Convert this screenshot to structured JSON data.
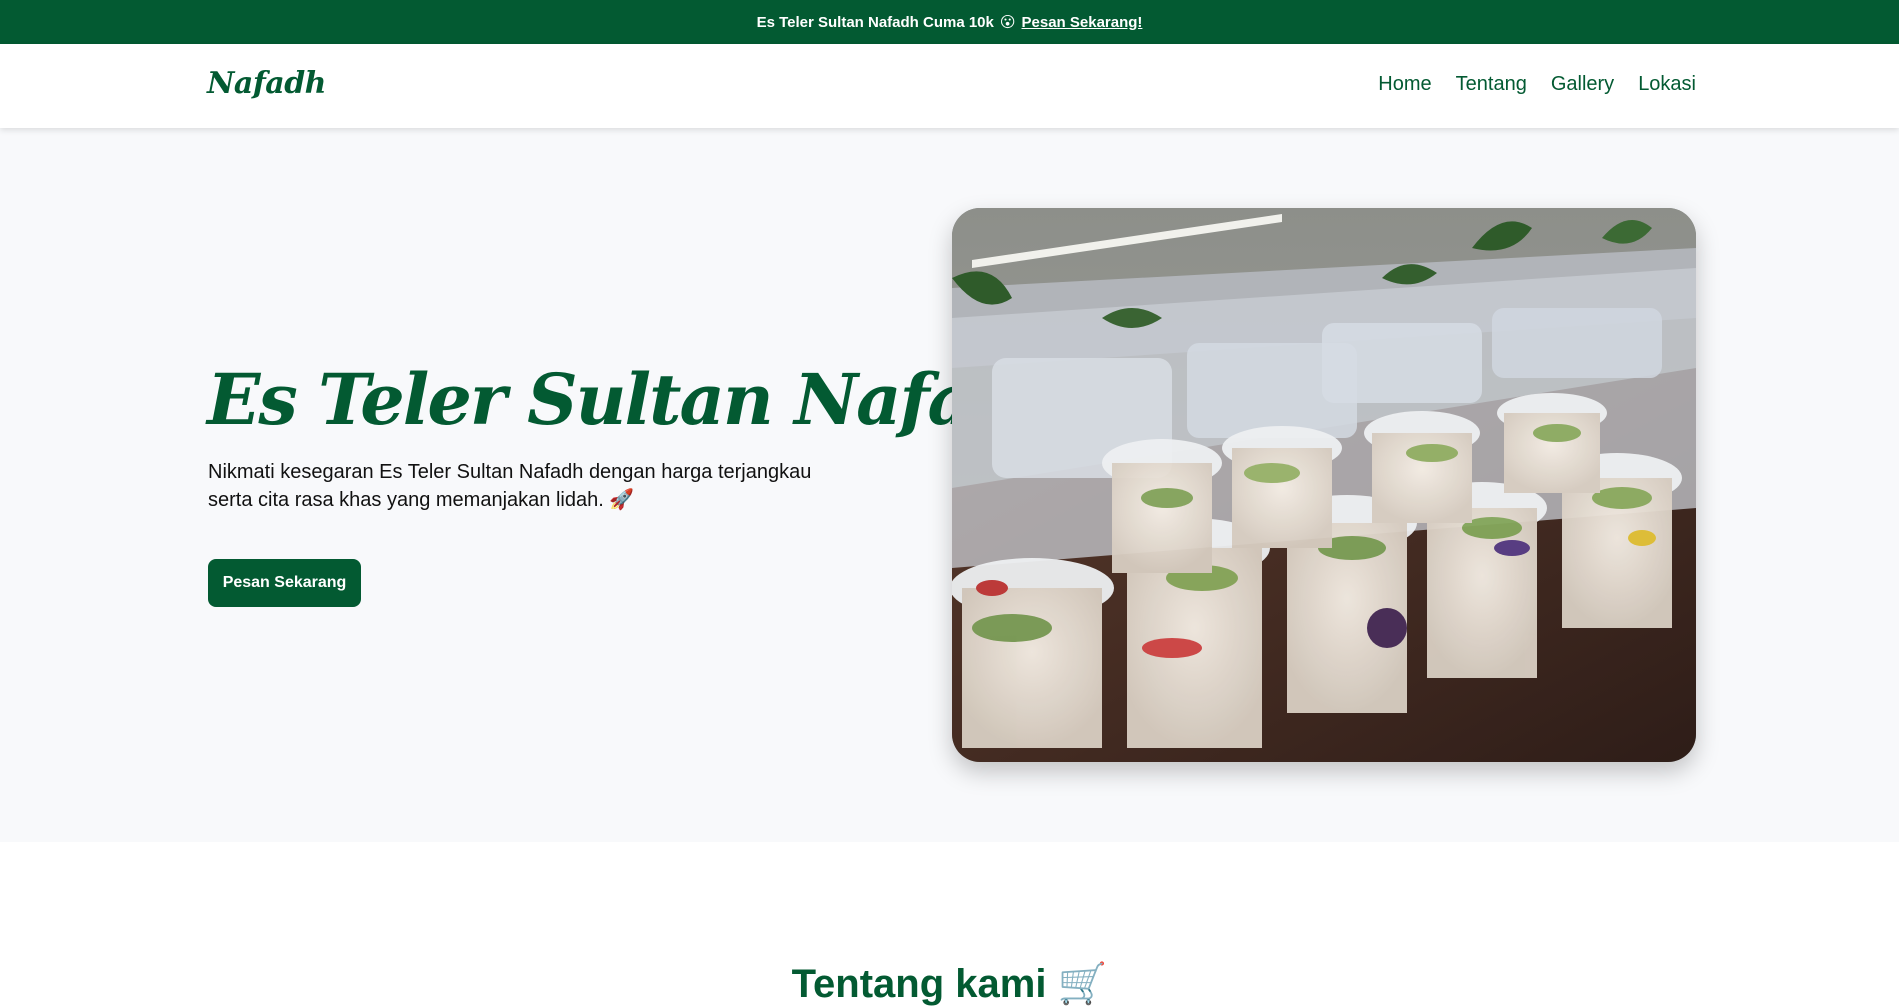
{
  "announcement": {
    "text": "Es Teler Sultan Nafadh Cuma 10k",
    "emoji": "😮",
    "link_label": "Pesan Sekarang!"
  },
  "nav": {
    "logo": "Nafadh",
    "links": [
      "Home",
      "Tentang",
      "Gallery",
      "Lokasi"
    ]
  },
  "hero": {
    "title": "Es Teler Sultan Nafadh",
    "description": "Nikmati kesegaran Es Teler Sultan Nafadh dengan harga terjangkau serta cita rasa khas yang memanjakan lidah.",
    "description_emoji": "🚀",
    "cta_label": "Pesan Sekarang"
  },
  "about": {
    "title": "Tentang kami",
    "emoji": "🛒"
  },
  "colors": {
    "brand_green": "#035a32",
    "hero_bg": "#f8f9fb",
    "page_bg": "#ffffff"
  },
  "icons": [
    "astonished-face-emoji",
    "rocket-emoji",
    "shopping-cart-emoji"
  ]
}
